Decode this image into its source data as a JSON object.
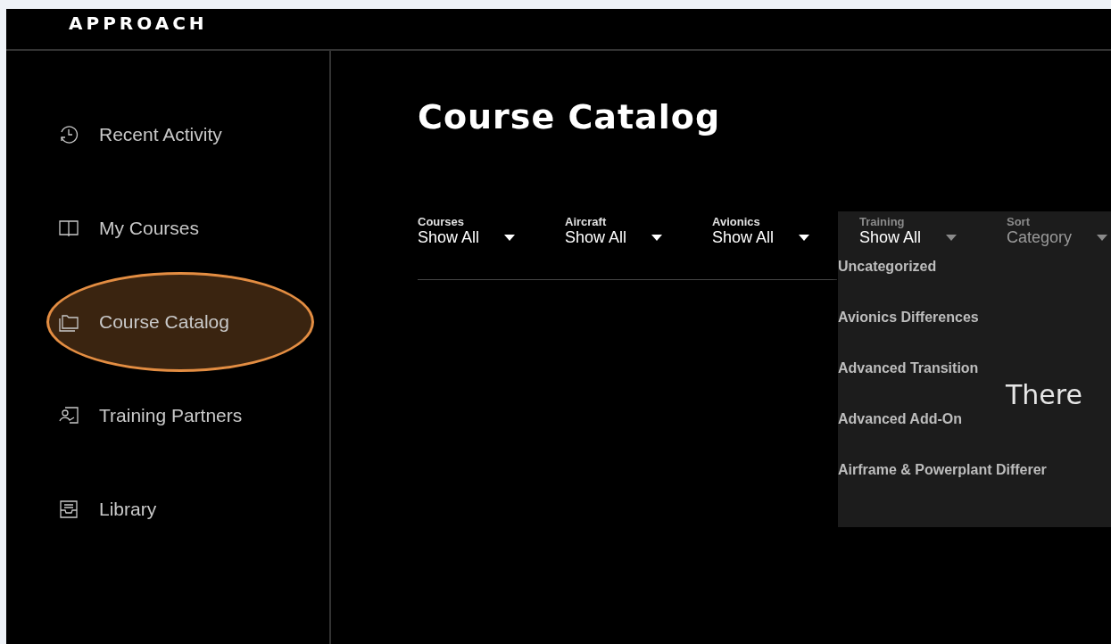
{
  "header": {
    "logo": "APPROACH"
  },
  "sidebar": {
    "items": [
      {
        "label": "Recent Activity",
        "selected": false
      },
      {
        "label": "My Courses",
        "selected": false
      },
      {
        "label": "Course Catalog",
        "selected": true
      },
      {
        "label": "Training Partners",
        "selected": false
      },
      {
        "label": "Library",
        "selected": false
      }
    ]
  },
  "main": {
    "title": "Course Catalog",
    "filters": [
      {
        "label": "Courses",
        "value": "Show All",
        "open": false,
        "dimmed": false
      },
      {
        "label": "Aircraft",
        "value": "Show All",
        "open": false,
        "dimmed": false
      },
      {
        "label": "Avionics",
        "value": "Show All",
        "open": false,
        "dimmed": false
      },
      {
        "label": "Training",
        "value": "Show All",
        "open": true,
        "dimmed": false
      },
      {
        "label": "Sort",
        "value": "Category",
        "open": false,
        "dimmed": true
      }
    ],
    "dropdown_options": [
      "Uncategorized",
      "Avionics Differences",
      "Advanced Transition",
      "Advanced Add-On",
      "Airframe & Powerplant Differer"
    ],
    "empty_message": "There"
  }
}
